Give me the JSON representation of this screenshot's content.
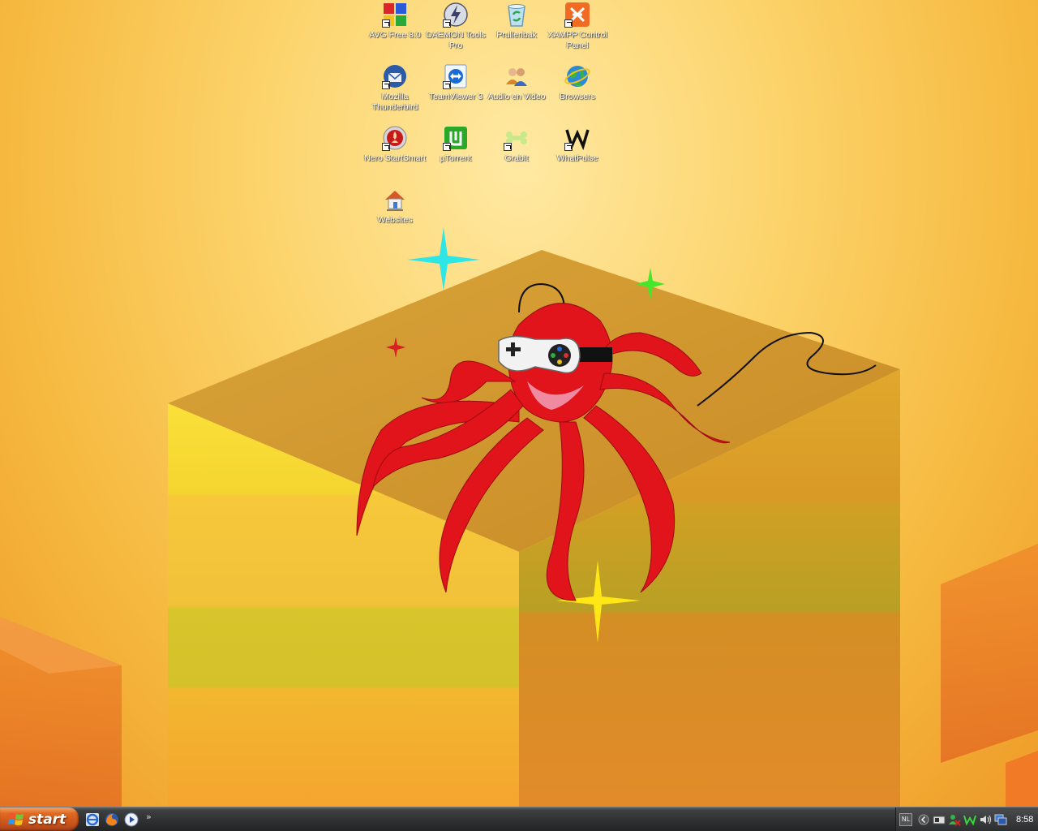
{
  "desktop": {
    "icons": [
      {
        "label": "AVG Free 8.0",
        "icon": "avg-icon",
        "shortcut": true
      },
      {
        "label": "DAEMON Tools Pro",
        "icon": "daemon-tools-icon",
        "shortcut": true
      },
      {
        "label": "Prullenbak",
        "icon": "recycle-bin-icon",
        "shortcut": false
      },
      {
        "label": "XAMPP Control Panel",
        "icon": "xampp-icon",
        "shortcut": true
      },
      {
        "label": "Mozilla Thunderbird",
        "icon": "thunderbird-icon",
        "shortcut": true
      },
      {
        "label": "TeamViewer 3",
        "icon": "teamviewer-icon",
        "shortcut": true
      },
      {
        "label": "Audio en Video",
        "icon": "users-folder-icon",
        "shortcut": false
      },
      {
        "label": "Browsers",
        "icon": "globe-icon",
        "shortcut": false
      },
      {
        "label": "Nero StartSmart",
        "icon": "nero-icon",
        "shortcut": true
      },
      {
        "label": "µTorrent",
        "icon": "utorrent-icon",
        "shortcut": true
      },
      {
        "label": "GrabIt",
        "icon": "grabit-icon",
        "shortcut": true
      },
      {
        "label": "WhatPulse",
        "icon": "whatpulse-icon",
        "shortcut": true
      },
      {
        "label": "Websites",
        "icon": "house-network-icon",
        "shortcut": false
      }
    ]
  },
  "taskbar": {
    "start_label": "start",
    "quick_launch": [
      "ie-icon",
      "firefox-icon",
      "media-player-icon"
    ],
    "quick_launch_more": "»",
    "tray": {
      "language": "NL",
      "clock": "8:58"
    }
  },
  "colors": {
    "start_button": "#d9581c",
    "taskbar": "#2d2f31",
    "wallpaper_sky": "#fcd46c",
    "octopus": "#e0141a"
  }
}
